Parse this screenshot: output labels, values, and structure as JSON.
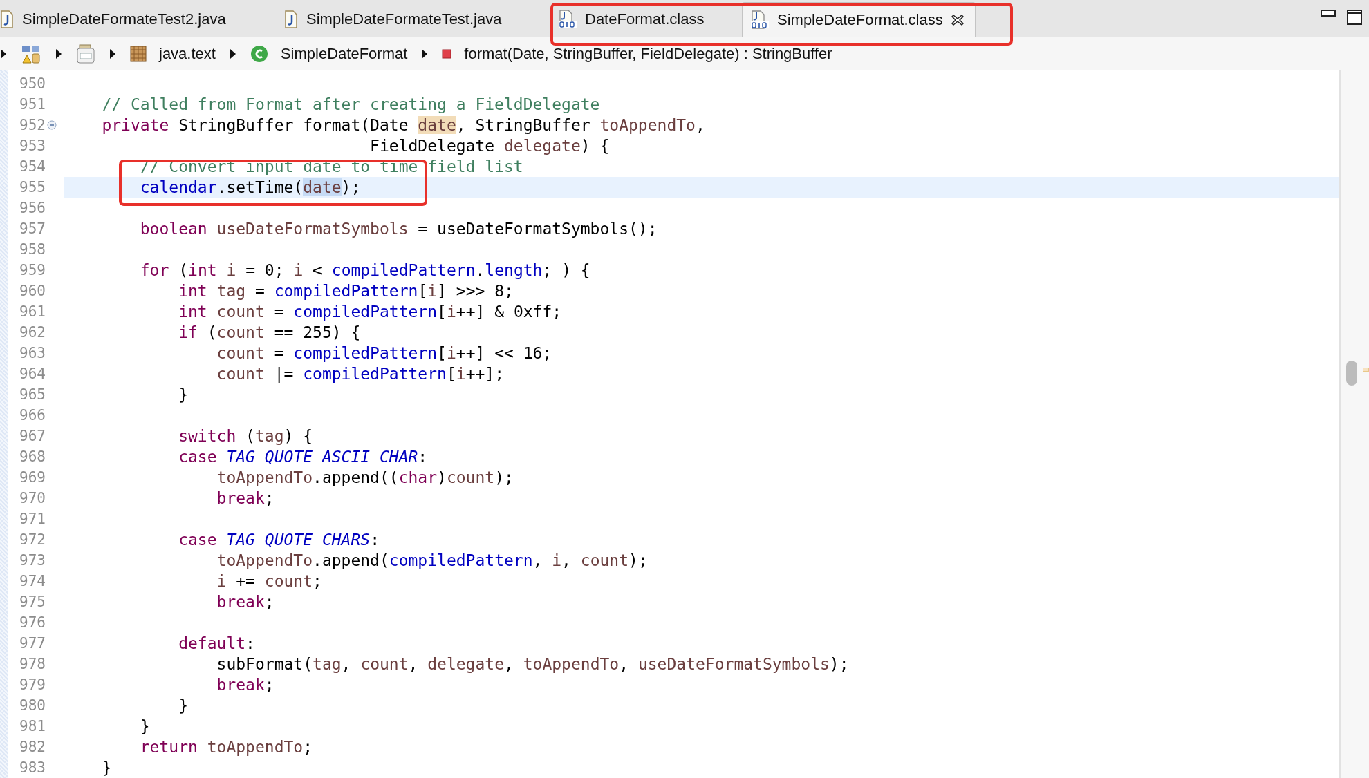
{
  "tabs": [
    {
      "label": "SimpleDateFormateTest2.java",
      "kind": "java",
      "selected": false
    },
    {
      "label": "SimpleDateFormateTest.java",
      "kind": "java",
      "selected": false
    },
    {
      "label": "DateFormat.class",
      "kind": "class",
      "selected": false
    },
    {
      "label": "SimpleDateFormat.class",
      "kind": "class",
      "selected": true
    }
  ],
  "breadcrumb": [
    {
      "kind": "project"
    },
    {
      "kind": "jar"
    },
    {
      "kind": "package",
      "label": "java.text"
    },
    {
      "kind": "class",
      "label": "SimpleDateFormat"
    },
    {
      "kind": "method",
      "label": "format(Date, StringBuffer, FieldDelegate) : StringBuffer"
    }
  ],
  "lines": [
    {
      "number": "950"
    },
    {
      "number": "951",
      "tokens": [
        {
          "text": "    // Called from Format after creating a FieldDelegate",
          "kind": "comment"
        }
      ]
    },
    {
      "number": "952",
      "fold": true,
      "tokens": [
        {
          "text": "    private",
          "kind": "keyword"
        },
        {
          "text": " StringBuffer format(Date ",
          "kind": "plain"
        },
        {
          "text": "date",
          "kind": "local",
          "occurrence": true
        },
        {
          "text": ", StringBuffer ",
          "kind": "plain"
        },
        {
          "text": "toAppendTo",
          "kind": "local"
        },
        {
          "text": ",",
          "kind": "plain"
        }
      ]
    },
    {
      "number": "953",
      "tokens": [
        {
          "text": "                                FieldDelegate ",
          "kind": "plain"
        },
        {
          "text": "delegate",
          "kind": "local"
        },
        {
          "text": ") {",
          "kind": "plain"
        }
      ]
    },
    {
      "number": "954",
      "tokens": [
        {
          "text": "        // Convert input date to time field list",
          "kind": "comment"
        }
      ]
    },
    {
      "number": "955",
      "current": true,
      "tokens": [
        {
          "text": "        calendar",
          "kind": "field"
        },
        {
          "text": ".setTime(",
          "kind": "plain"
        },
        {
          "text": "date",
          "kind": "local",
          "selected": true
        },
        {
          "text": ");",
          "kind": "plain"
        }
      ]
    },
    {
      "number": "956"
    },
    {
      "number": "957",
      "tokens": [
        {
          "text": "        boolean ",
          "kind": "keyword"
        },
        {
          "text": "useDateFormatSymbols",
          "kind": "local"
        },
        {
          "text": " = useDateFormatSymbols();",
          "kind": "plain"
        }
      ]
    },
    {
      "number": "958"
    },
    {
      "number": "959",
      "tokens": [
        {
          "text": "        for",
          "kind": "keyword"
        },
        {
          "text": " (",
          "kind": "plain"
        },
        {
          "text": "int ",
          "kind": "keyword"
        },
        {
          "text": "i",
          "kind": "local"
        },
        {
          "text": " = 0; ",
          "kind": "plain"
        },
        {
          "text": "i",
          "kind": "local"
        },
        {
          "text": " < ",
          "kind": "plain"
        },
        {
          "text": "compiledPattern",
          "kind": "field"
        },
        {
          "text": ".",
          "kind": "plain"
        },
        {
          "text": "length",
          "kind": "field"
        },
        {
          "text": "; ) {",
          "kind": "plain"
        }
      ]
    },
    {
      "number": "960",
      "tokens": [
        {
          "text": "            int ",
          "kind": "keyword"
        },
        {
          "text": "tag",
          "kind": "local"
        },
        {
          "text": " = ",
          "kind": "plain"
        },
        {
          "text": "compiledPattern",
          "kind": "field"
        },
        {
          "text": "[",
          "kind": "plain"
        },
        {
          "text": "i",
          "kind": "local"
        },
        {
          "text": "] >>> 8;",
          "kind": "plain"
        }
      ]
    },
    {
      "number": "961",
      "tokens": [
        {
          "text": "            int ",
          "kind": "keyword"
        },
        {
          "text": "count",
          "kind": "local"
        },
        {
          "text": " = ",
          "kind": "plain"
        },
        {
          "text": "compiledPattern",
          "kind": "field"
        },
        {
          "text": "[",
          "kind": "plain"
        },
        {
          "text": "i",
          "kind": "local"
        },
        {
          "text": "++] & 0xff;",
          "kind": "plain"
        }
      ]
    },
    {
      "number": "962",
      "tokens": [
        {
          "text": "            if",
          "kind": "keyword"
        },
        {
          "text": " (",
          "kind": "plain"
        },
        {
          "text": "count",
          "kind": "local"
        },
        {
          "text": " == 255) {",
          "kind": "plain"
        }
      ]
    },
    {
      "number": "963",
      "tokens": [
        {
          "text": "                count",
          "kind": "local"
        },
        {
          "text": " = ",
          "kind": "plain"
        },
        {
          "text": "compiledPattern",
          "kind": "field"
        },
        {
          "text": "[",
          "kind": "plain"
        },
        {
          "text": "i",
          "kind": "local"
        },
        {
          "text": "++] << 16;",
          "kind": "plain"
        }
      ]
    },
    {
      "number": "964",
      "tokens": [
        {
          "text": "                count",
          "kind": "local"
        },
        {
          "text": " |= ",
          "kind": "plain"
        },
        {
          "text": "compiledPattern",
          "kind": "field"
        },
        {
          "text": "[",
          "kind": "plain"
        },
        {
          "text": "i",
          "kind": "local"
        },
        {
          "text": "++];",
          "kind": "plain"
        }
      ]
    },
    {
      "number": "965",
      "tokens": [
        {
          "text": "            }",
          "kind": "plain"
        }
      ]
    },
    {
      "number": "966"
    },
    {
      "number": "967",
      "tokens": [
        {
          "text": "            switch",
          "kind": "keyword"
        },
        {
          "text": " (",
          "kind": "plain"
        },
        {
          "text": "tag",
          "kind": "local"
        },
        {
          "text": ") {",
          "kind": "plain"
        }
      ]
    },
    {
      "number": "968",
      "tokens": [
        {
          "text": "            case ",
          "kind": "keyword"
        },
        {
          "text": "TAG_QUOTE_ASCII_CHAR",
          "kind": "static"
        },
        {
          "text": ":",
          "kind": "plain"
        }
      ]
    },
    {
      "number": "969",
      "tokens": [
        {
          "text": "                toAppendTo",
          "kind": "local"
        },
        {
          "text": ".append((",
          "kind": "plain"
        },
        {
          "text": "char",
          "kind": "keyword"
        },
        {
          "text": ")",
          "kind": "plain"
        },
        {
          "text": "count",
          "kind": "local"
        },
        {
          "text": ");",
          "kind": "plain"
        }
      ]
    },
    {
      "number": "970",
      "tokens": [
        {
          "text": "                break",
          "kind": "keyword"
        },
        {
          "text": ";",
          "kind": "plain"
        }
      ]
    },
    {
      "number": "971"
    },
    {
      "number": "972",
      "tokens": [
        {
          "text": "            case ",
          "kind": "keyword"
        },
        {
          "text": "TAG_QUOTE_CHARS",
          "kind": "static"
        },
        {
          "text": ":",
          "kind": "plain"
        }
      ]
    },
    {
      "number": "973",
      "tokens": [
        {
          "text": "                toAppendTo",
          "kind": "local"
        },
        {
          "text": ".append(",
          "kind": "plain"
        },
        {
          "text": "compiledPattern",
          "kind": "field"
        },
        {
          "text": ", ",
          "kind": "plain"
        },
        {
          "text": "i",
          "kind": "local"
        },
        {
          "text": ", ",
          "kind": "plain"
        },
        {
          "text": "count",
          "kind": "local"
        },
        {
          "text": ");",
          "kind": "plain"
        }
      ]
    },
    {
      "number": "974",
      "tokens": [
        {
          "text": "                i",
          "kind": "local"
        },
        {
          "text": " += ",
          "kind": "plain"
        },
        {
          "text": "count",
          "kind": "local"
        },
        {
          "text": ";",
          "kind": "plain"
        }
      ]
    },
    {
      "number": "975",
      "tokens": [
        {
          "text": "                break",
          "kind": "keyword"
        },
        {
          "text": ";",
          "kind": "plain"
        }
      ]
    },
    {
      "number": "976"
    },
    {
      "number": "977",
      "tokens": [
        {
          "text": "            default",
          "kind": "keyword"
        },
        {
          "text": ":",
          "kind": "plain"
        }
      ]
    },
    {
      "number": "978",
      "tokens": [
        {
          "text": "                subFormat(",
          "kind": "plain"
        },
        {
          "text": "tag",
          "kind": "local"
        },
        {
          "text": ", ",
          "kind": "plain"
        },
        {
          "text": "count",
          "kind": "local"
        },
        {
          "text": ", ",
          "kind": "plain"
        },
        {
          "text": "delegate",
          "kind": "local"
        },
        {
          "text": ", ",
          "kind": "plain"
        },
        {
          "text": "toAppendTo",
          "kind": "local"
        },
        {
          "text": ", ",
          "kind": "plain"
        },
        {
          "text": "useDateFormatSymbols",
          "kind": "local"
        },
        {
          "text": ");",
          "kind": "plain"
        }
      ]
    },
    {
      "number": "979",
      "tokens": [
        {
          "text": "                break",
          "kind": "keyword"
        },
        {
          "text": ";",
          "kind": "plain"
        }
      ]
    },
    {
      "number": "980",
      "tokens": [
        {
          "text": "            }",
          "kind": "plain"
        }
      ]
    },
    {
      "number": "981",
      "tokens": [
        {
          "text": "        }",
          "kind": "plain"
        }
      ]
    },
    {
      "number": "982",
      "tokens": [
        {
          "text": "        return ",
          "kind": "keyword"
        },
        {
          "text": "toAppendTo",
          "kind": "local"
        },
        {
          "text": ";",
          "kind": "plain"
        }
      ]
    },
    {
      "number": "983",
      "tokens": [
        {
          "text": "    }",
          "kind": "plain"
        }
      ]
    }
  ]
}
